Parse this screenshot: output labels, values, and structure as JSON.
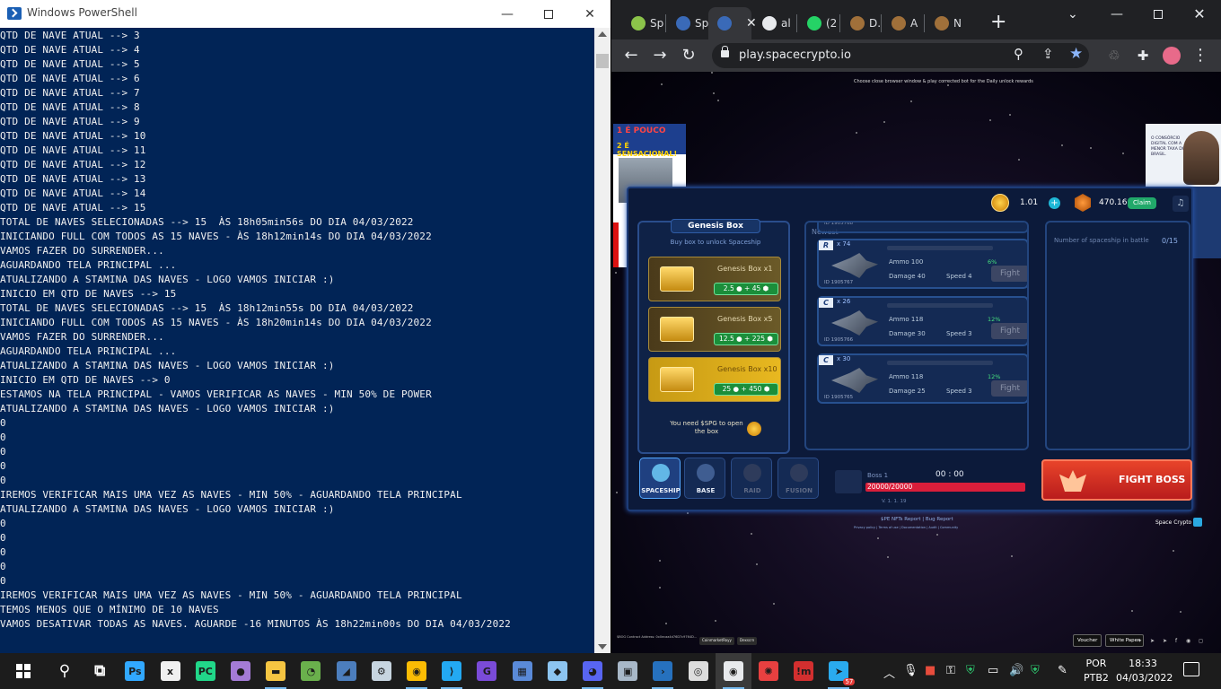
{
  "powershell": {
    "title": "Windows PowerShell",
    "lines": [
      "QTD DE NAVE ATUAL --> 3",
      "QTD DE NAVE ATUAL --> 4",
      "QTD DE NAVE ATUAL --> 5",
      "QTD DE NAVE ATUAL --> 6",
      "QTD DE NAVE ATUAL --> 7",
      "QTD DE NAVE ATUAL --> 8",
      "QTD DE NAVE ATUAL --> 9",
      "QTD DE NAVE ATUAL --> 10",
      "QTD DE NAVE ATUAL --> 11",
      "QTD DE NAVE ATUAL --> 12",
      "QTD DE NAVE ATUAL --> 13",
      "QTD DE NAVE ATUAL --> 14",
      "QTD DE NAVE ATUAL --> 15",
      "TOTAL DE NAVES SELECIONADAS --> 15  ÀS 18h05min56s DO DIA 04/03/2022",
      "INICIANDO FULL COM TODOS AS 15 NAVES - ÀS 18h12min14s DO DIA 04/03/2022",
      "VAMOS FAZER DO SURRENDER...",
      "AGUARDANDO TELA PRINCIPAL ...",
      "ATUALIZANDO A STAMINA DAS NAVES - LOGO VAMOS INICIAR :)",
      "INICIO EM QTD DE NAVES --> 15",
      "TOTAL DE NAVES SELECIONADAS --> 15  ÀS 18h12min55s DO DIA 04/03/2022",
      "INICIANDO FULL COM TODOS AS 15 NAVES - ÀS 18h20min14s DO DIA 04/03/2022",
      "VAMOS FAZER DO SURRENDER...",
      "AGUARDANDO TELA PRINCIPAL ...",
      "ATUALIZANDO A STAMINA DAS NAVES - LOGO VAMOS INICIAR :)",
      "INICIO EM QTD DE NAVES --> 0",
      "ESTAMOS NA TELA PRINCIPAL - VAMOS VERIFICAR AS NAVES - MIN 50% DE POWER",
      "ATUALIZANDO A STAMINA DAS NAVES - LOGO VAMOS INICIAR :)",
      "0",
      "0",
      "0",
      "0",
      "0",
      "IREMOS VERIFICAR MAIS UMA VEZ AS NAVES - MIN 50% - AGUARDANDO TELA PRINCIPAL",
      "ATUALIZANDO A STAMINA DAS NAVES - LOGO VAMOS INICIAR :)",
      "0",
      "0",
      "0",
      "0",
      "0",
      "IREMOS VERIFICAR MAIS UMA VEZ AS NAVES - MIN 50% - AGUARDANDO TELA PRINCIPAL",
      "TEMOS MENOS QUE O MÍNIMO DE 10 NAVES",
      "VAMOS DESATIVAR TODAS AS NAVES. AGUARDE -16 MINUTOS ÀS 18h22min00s DO DIA 04/03/2022"
    ]
  },
  "chrome": {
    "tabs": [
      {
        "label": "Sp",
        "icon": "green-circle-icon",
        "color": "#8bc34a"
      },
      {
        "label": "Sp",
        "icon": "spacecrypto-icon",
        "color": "#3a6ab8"
      },
      {
        "label": "",
        "icon": "spacecrypto-icon",
        "color": "#3a6ab8",
        "active": true
      },
      {
        "label": "al",
        "icon": "globe-icon",
        "color": "#e8eaed"
      },
      {
        "label": "(2",
        "icon": "whatsapp-icon",
        "color": "#25d366"
      },
      {
        "label": "D.",
        "icon": "miner-icon",
        "color": "#a0703a"
      },
      {
        "label": "A",
        "icon": "miner-icon",
        "color": "#a0703a"
      },
      {
        "label": "N",
        "icon": "miner-icon",
        "color": "#a0703a"
      }
    ],
    "tab_close": "✕",
    "new_tab": "+",
    "url": "play.spacecrypto.io",
    "colors": {
      "star": "#8ab4f8"
    }
  },
  "game": {
    "notice": "Choose close browser window & play corrected bot for the Daily unlock rewards",
    "ad_left": {
      "line1": "1 É POUCO",
      "line2": "2 É SENSACIONAL!"
    },
    "ad_right": {
      "text": "O CONSÓRCIO DIGITAL COM A MENOR TAXA DO BRASIL."
    },
    "spg_balance": "1.01",
    "sp_balance": "470.16",
    "claim_label": "Claim",
    "genesis": {
      "title": "Genesis Box",
      "subtitle": "Buy box to unlock Spaceship",
      "boxes": [
        {
          "name": "Genesis Box x1",
          "price": "2.5 ● + 45 ⬢"
        },
        {
          "name": "Genesis Box x5",
          "price": "12.5 ● + 225 ⬢"
        },
        {
          "name": "Genesis Box x10",
          "price": "25 ● + 450 ⬢"
        }
      ],
      "need_text": "You need $SPG to open the box"
    },
    "shiplist": {
      "filter": "Newest",
      "prev": "«",
      "next": "»",
      "top_partial_id": "ID 1905768",
      "ships": [
        {
          "rarity": "R",
          "level": "x 74",
          "id": "ID 1905767",
          "ammo": "Ammo 100",
          "percent": "6%",
          "damage": "Damage 40",
          "speed": "Speed 4",
          "fight": "Fight"
        },
        {
          "rarity": "C",
          "level": "x 26",
          "id": "ID 1905766",
          "ammo": "Ammo 118",
          "percent": "12%",
          "damage": "Damage 30",
          "speed": "Speed 3",
          "fight": "Fight"
        },
        {
          "rarity": "C",
          "level": "x 30",
          "id": "ID 1905765",
          "ammo": "Ammo 118",
          "percent": "12%",
          "damage": "Damage 25",
          "speed": "Speed 3",
          "fight": "Fight"
        }
      ]
    },
    "battle": {
      "label": "Number of spaceship in battle",
      "count": "0/15"
    },
    "nav": [
      {
        "label": "SPACESHIP",
        "active": true
      },
      {
        "label": "BASE",
        "active": false
      },
      {
        "label": "RAID",
        "active": false
      },
      {
        "label": "FUSION",
        "active": false
      }
    ],
    "boss": {
      "name": "Boss 1",
      "time": "00 : 00",
      "hp": "20000/20000"
    },
    "fight_boss": "FIGHT BOSS",
    "version": "V. 1. 1. 19",
    "report": "$PE NFTs Report | Bug Report",
    "report_small": "Privacy policy | Terms of use | Documentation | Audit | Community",
    "brand": "Space Crypto",
    "bottom": {
      "addr": "$BOG Contract Address: 0x0ecaa4d76D7c9764D...",
      "chip1": "CoinmarketRoyy",
      "chip2": "Dexscrn",
      "btn1": "Voucher",
      "btn2": "White Paper"
    }
  },
  "taskbar": {
    "apps": [
      {
        "name": "search-icon",
        "color": "#fff"
      },
      {
        "name": "task-view-icon",
        "color": "#fff"
      },
      {
        "name": "photoshop-icon",
        "color": "#31a8ff"
      },
      {
        "name": "mathtype-icon",
        "color": "#f0f0f0"
      },
      {
        "name": "pycharm-icon",
        "color": "#21d789"
      },
      {
        "name": "github-icon",
        "color": "#a47bd6"
      },
      {
        "name": "file-explorer-icon",
        "color": "#f5c542"
      },
      {
        "name": "app-green-icon",
        "color": "#6ab04c"
      },
      {
        "name": "wireshark-icon",
        "color": "#4c7ebd"
      },
      {
        "name": "steam-icon",
        "color": "#c7d5e0"
      },
      {
        "name": "chrome-icon",
        "color": "#fbbc04"
      },
      {
        "name": "vscode-icon",
        "color": "#23a9f2"
      },
      {
        "name": "pdf-gear-icon",
        "color": "#7a4bd8"
      },
      {
        "name": "network-icon",
        "color": "#5a8ad8"
      },
      {
        "name": "cube-icon",
        "color": "#8cc4f0"
      },
      {
        "name": "discord-icon",
        "color": "#5865f2"
      },
      {
        "name": "monitor-icon",
        "color": "#a8b8c8"
      },
      {
        "name": "powershell-icon",
        "color": "#2671be"
      },
      {
        "name": "obs-icon",
        "color": "#dddddd"
      },
      {
        "name": "chrome-profile-icon",
        "color": "#e8eaed"
      },
      {
        "name": "bomb-icon",
        "color": "#e84040"
      },
      {
        "name": "mimo-icon",
        "color": "#d32f2f"
      },
      {
        "name": "telegram-icon",
        "color": "#2aabee"
      }
    ],
    "telegram_badge": "57",
    "lang_line1": "POR",
    "lang_line2": "PTB2",
    "time": "18:33",
    "date": "04/03/2022"
  }
}
